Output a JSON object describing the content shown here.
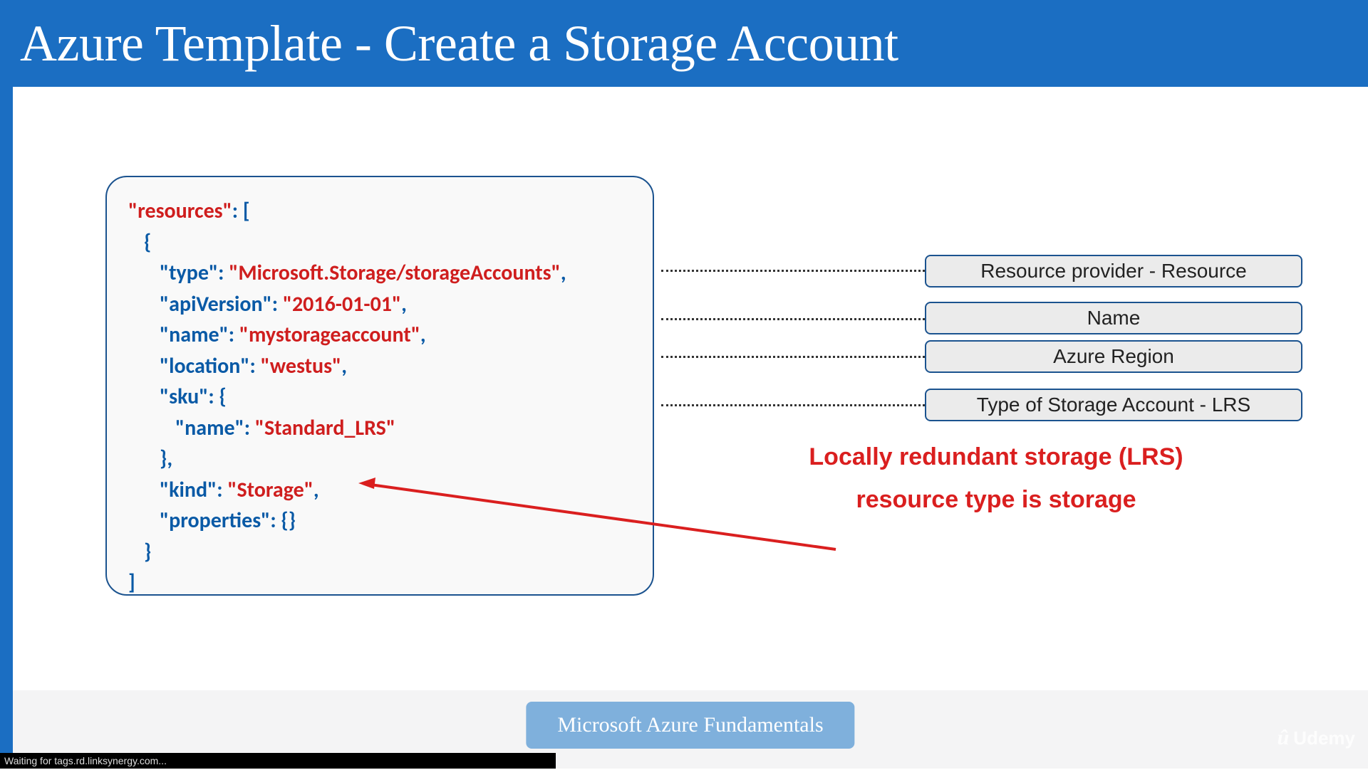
{
  "header": {
    "title": "Azure Template - Create a Storage Account"
  },
  "code": {
    "resources_key": "\"resources\"",
    "open_bracket": ": [",
    "open_brace": "{",
    "type_key": "\"type\"",
    "type_val": "\"Microsoft.Storage/storageAccounts\"",
    "api_key": "\"apiVersion\"",
    "api_val": "\"2016-01-01\"",
    "name_key": "\"name\"",
    "name_val": "\"mystorageaccount\"",
    "loc_key": "\"location\"",
    "loc_val": "\"westus\"",
    "sku_key": "\"sku\"",
    "sku_open": ": {",
    "sku_name_key": "\"name\"",
    "sku_name_val": "\"Standard_LRS\"",
    "sku_close": "},",
    "kind_key": "\"kind\"",
    "kind_val": "\"Storage\"",
    "props_key": "\"properties\"",
    "props_val": ": {}",
    "close_brace": "}",
    "close_bracket": "]"
  },
  "labels": {
    "provider": "Resource provider - Resource",
    "name": "Name",
    "region": "Azure Region",
    "sku": "Type of Storage Account - LRS"
  },
  "callout": {
    "line1": "Locally redundant storage (LRS)",
    "line2": "resource type is storage"
  },
  "footer": {
    "pill": "Microsoft Azure Fundamentals"
  },
  "status": {
    "text": "Waiting for tags.rd.linksynergy.com..."
  },
  "brand": {
    "name": "Udemy"
  }
}
